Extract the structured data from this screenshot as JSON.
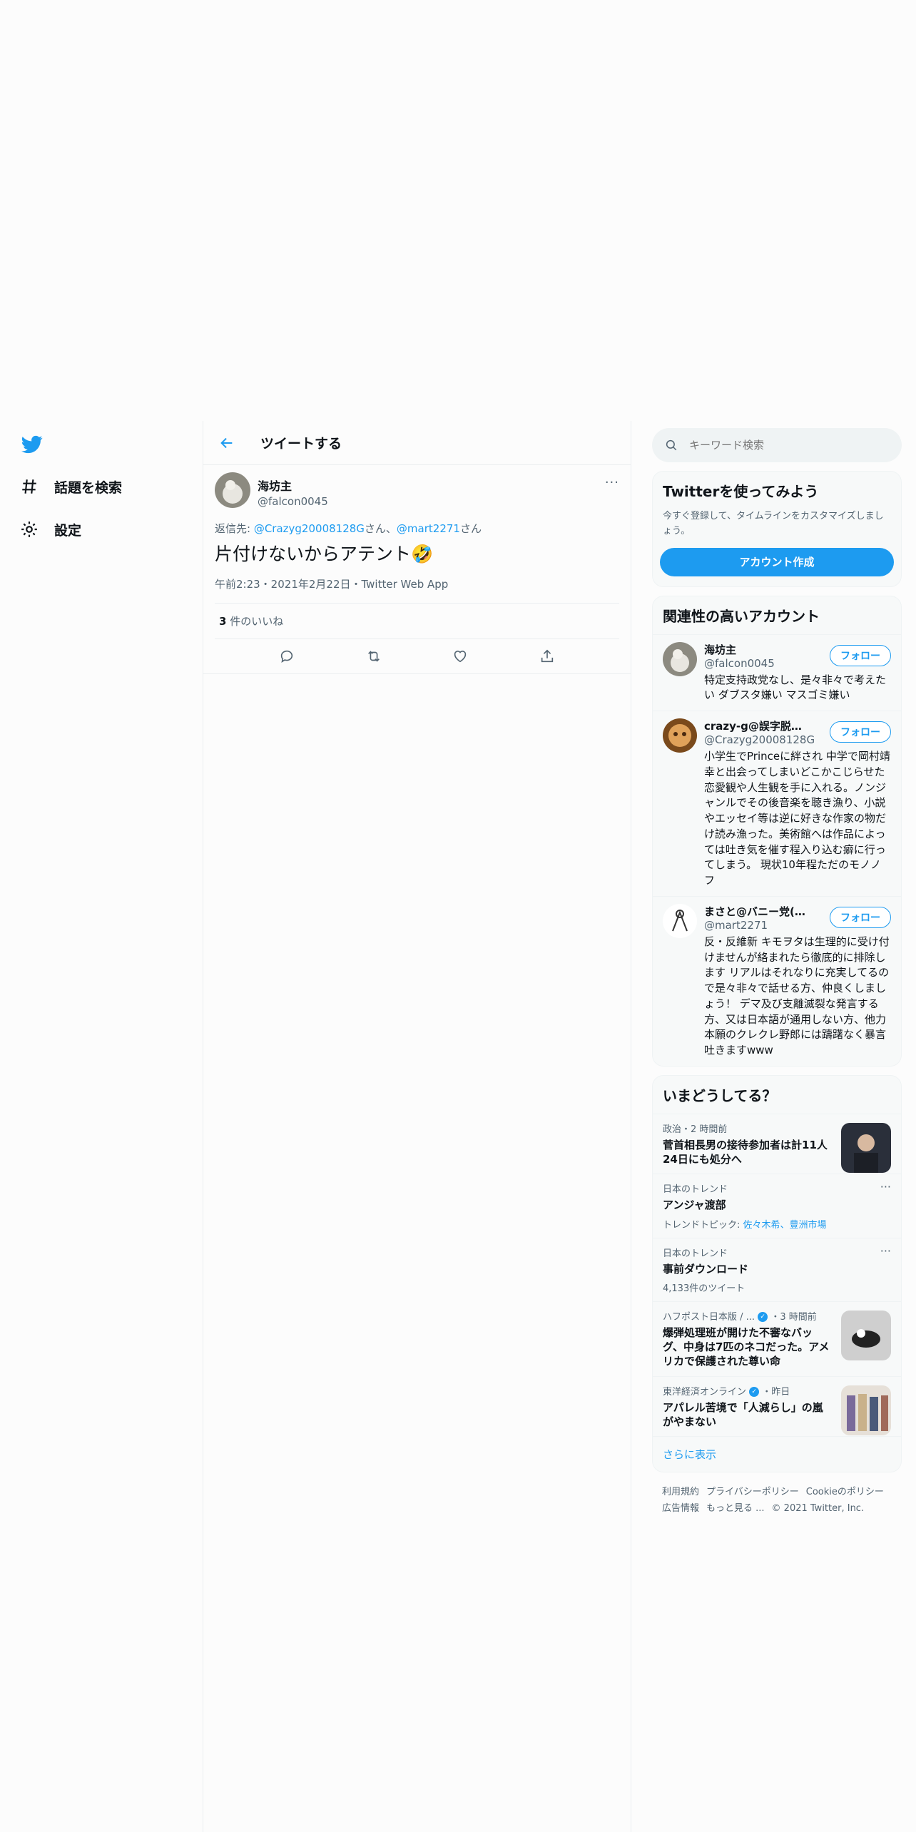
{
  "nav": {
    "explore_label": "話題を検索",
    "settings_label": "設定"
  },
  "header": {
    "title": "ツイートする"
  },
  "tweet": {
    "author_name": "海坊主",
    "author_handle": "@falcon0045",
    "reply_prefix": "返信先: ",
    "reply_user1": "@Crazyg20008128G",
    "reply_sep1": "さん、",
    "reply_user2": "@mart2271",
    "reply_sep2": "さん",
    "text": "片付けないからアテント🤣",
    "meta": "午前2:23・2021年2月22日・Twitter Web App",
    "likes_count": "3",
    "likes_label": " 件のいいね"
  },
  "search": {
    "placeholder": "キーワード検索"
  },
  "signup": {
    "title": "Twitterを使ってみよう",
    "desc": "今すぐ登録して、タイムラインをカスタマイズしましょう。",
    "button": "アカウント作成"
  },
  "related": {
    "title": "関連性の高いアカウント",
    "follow_label": "フォロー",
    "accounts": [
      {
        "name": "海坊主",
        "handle": "@falcon0045",
        "bio": "特定支持政党なし、是々非々で考えたい ダブスタ嫌い マスゴミ嫌い"
      },
      {
        "name": "crazy-g@誤字脱字（ひら…",
        "handle": "@Crazyg20008128G",
        "bio": "小学生でPrinceに絆され 中学で岡村靖幸と出会ってしまいどこかこじらせた恋愛観や人生観を手に入れる。ノンジャンルでその後音楽を聴き漁り、小説やエッセイ等は逆に好きな作家の物だけ読み漁った。美術館へは作品によっては吐き気を催す程入り込む癖に行ってしまう。 現状10年程ただのモノノフ"
      },
      {
        "name": "まさと@バニー党(し…",
        "handle": "@mart2271",
        "bio": "反・反維新 キモヲタは生理的に受け付けませんが絡まれたら徹底的に排除します リアルはそれなりに充実してるので是々非々で話せる方、仲良くしましょう！ デマ及び支離滅裂な発言する方、又は日本語が通用しない方、他力本願のクレクレ野郎には躊躇なく暴言吐きますwww"
      }
    ]
  },
  "trends": {
    "title": "いまどうしてる？",
    "items": [
      {
        "meta": "政治・2 時間前",
        "title": "菅首相長男の接待参加者は計11人 24日にも処分へ",
        "sub": ""
      },
      {
        "meta": "日本のトレンド",
        "title": "アンジャ渡部",
        "sub_prefix": "トレンドトピック: ",
        "sub_links": "佐々木希、豊洲市場"
      },
      {
        "meta": "日本のトレンド",
        "title": "事前ダウンロード",
        "sub": "4,133件のツイート"
      },
      {
        "meta": "ハフポスト日本版 / ...",
        "meta_time": "・3 時間前",
        "title": "爆弾処理班が開けた不審なバッグ、中身は7匹のネコだった。アメリカで保護された尊い命"
      },
      {
        "meta": "東洋経済オンライン",
        "meta_time": "・昨日",
        "title": "アパレル苦境で「人減らし」の嵐がやまない"
      }
    ],
    "show_more": "さらに表示"
  },
  "footer": {
    "terms": "利用規約",
    "privacy": "プライバシーポリシー",
    "cookie": "Cookieのポリシー",
    "ads": "広告情報",
    "more": "もっと見る ...",
    "copyright": "© 2021 Twitter, Inc."
  },
  "colors": {
    "accent": "#1d9bf0",
    "text": "#0f1419",
    "muted": "#536471"
  },
  "icons": [
    "twitter-bird-icon",
    "hashtag-icon",
    "gear-icon",
    "back-arrow-icon",
    "more-icon",
    "reply-icon",
    "retweet-icon",
    "like-icon",
    "share-icon",
    "search-icon",
    "verified-icon"
  ]
}
